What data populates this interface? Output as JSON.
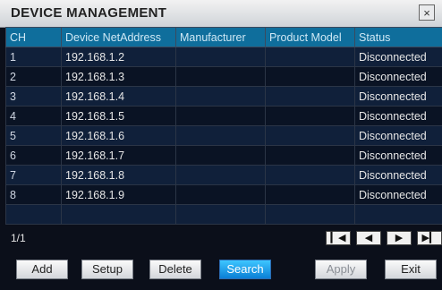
{
  "window": {
    "title": "DEVICE MANAGEMENT",
    "close_icon": "×"
  },
  "table": {
    "headers": [
      "CH",
      "Device NetAddress",
      "Manufacturer",
      "Product Model",
      "Status"
    ],
    "rows": [
      {
        "ch": "1",
        "addr": "192.168.1.2",
        "manufacturer": "",
        "model": "",
        "status": "Disconnected"
      },
      {
        "ch": "2",
        "addr": "192.168.1.3",
        "manufacturer": "",
        "model": "",
        "status": "Disconnected"
      },
      {
        "ch": "3",
        "addr": "192.168.1.4",
        "manufacturer": "",
        "model": "",
        "status": "Disconnected"
      },
      {
        "ch": "4",
        "addr": "192.168.1.5",
        "manufacturer": "",
        "model": "",
        "status": "Disconnected"
      },
      {
        "ch": "5",
        "addr": "192.168.1.6",
        "manufacturer": "",
        "model": "",
        "status": "Disconnected"
      },
      {
        "ch": "6",
        "addr": "192.168.1.7",
        "manufacturer": "",
        "model": "",
        "status": "Disconnected"
      },
      {
        "ch": "7",
        "addr": "192.168.1.8",
        "manufacturer": "",
        "model": "",
        "status": "Disconnected"
      },
      {
        "ch": "8",
        "addr": "192.168.1.9",
        "manufacturer": "",
        "model": "",
        "status": "Disconnected"
      },
      {
        "ch": "",
        "addr": "",
        "manufacturer": "",
        "model": "",
        "status": ""
      }
    ]
  },
  "pager": {
    "indicator": "1/1",
    "first_icon": "first-page-icon",
    "prev_icon": "prev-page-icon",
    "next_icon": "next-page-icon",
    "last_icon": "last-page-icon"
  },
  "buttons": {
    "add": "Add",
    "setup": "Setup",
    "delete": "Delete",
    "search": "Search",
    "apply": "Apply",
    "exit": "Exit"
  },
  "colors": {
    "header_bg": "#0f6e9c",
    "search_active": "#1ea4ef",
    "title_bar": "#dfe2e6"
  }
}
